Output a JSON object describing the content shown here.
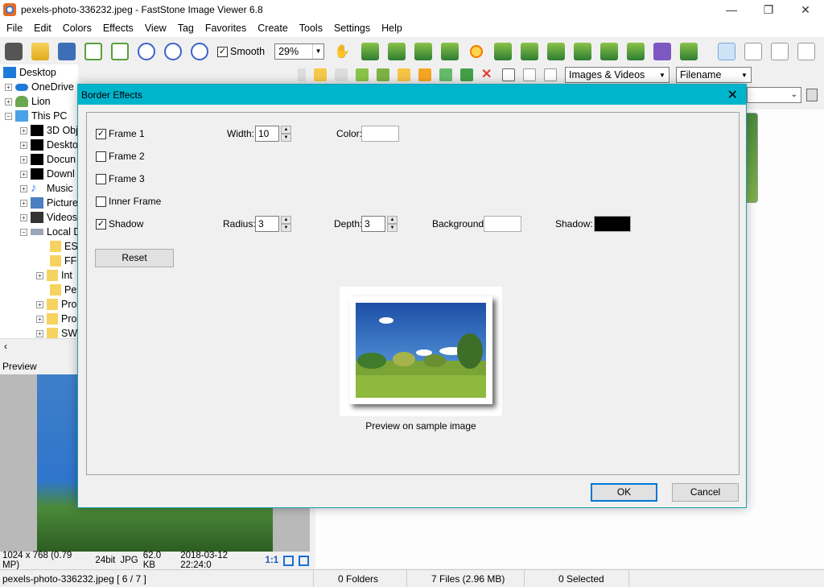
{
  "window": {
    "title": "pexels-photo-336232.jpeg - FastStone Image Viewer 6.8",
    "minimize": "—",
    "maximize": "❐",
    "close": "✕"
  },
  "menu": [
    "File",
    "Edit",
    "Colors",
    "Effects",
    "View",
    "Tag",
    "Favorites",
    "Create",
    "Tools",
    "Settings",
    "Help"
  ],
  "toolbar": {
    "smooth_label": "Smooth",
    "smooth_checked": "✓",
    "zoom_value": "29%"
  },
  "tree": {
    "items": [
      "Desktop",
      "OneDrive",
      "Lion",
      "This PC",
      "3D Obj",
      "Deskto",
      "Docun",
      "Downl",
      "Music",
      "Picture",
      "Videos",
      "Local D",
      "ESD",
      "FFO",
      "Int",
      "Per",
      "Pro",
      "Pro",
      "SW"
    ]
  },
  "browser": {
    "filter": "Images & Videos",
    "sort": "Filename"
  },
  "preview": {
    "label": "Preview",
    "dimensions": "1024 x 768 (0.79 MP)",
    "bits": "24bit",
    "format": "JPG",
    "size": "62.0 KB",
    "date": "2018-03-12 22:24:0",
    "ratio": "1:1"
  },
  "status": {
    "file": "pexels-photo-336232.jpeg [ 6 / 7 ]",
    "folders": "0 Folders",
    "files": "7 Files (2.96 MB)",
    "selected": "0 Selected"
  },
  "dialog": {
    "title": "Border Effects",
    "close": "✕",
    "frame1": "Frame 1",
    "frame2": "Frame 2",
    "frame3": "Frame 3",
    "inner_frame": "Inner Frame",
    "shadow": "Shadow",
    "check_mark": "✓",
    "width_label": "Width:",
    "width_value": "10",
    "color_label": "Color:",
    "radius_label": "Radius:",
    "radius_value": "3",
    "depth_label": "Depth:",
    "depth_value": "3",
    "background_label": "Background:",
    "shadow_label": "Shadow:",
    "reset": "Reset",
    "caption": "Preview on sample image",
    "ok": "OK",
    "cancel": "Cancel",
    "colors": {
      "frame_color": "#ffffff",
      "background": "#ffffff",
      "shadow": "#000000",
      "title_bar": "#00b4cc"
    }
  },
  "icons": [
    "camera-icon",
    "open-folder-icon",
    "save-icon",
    "prev-icon",
    "next-icon",
    "zoom-in-icon",
    "zoom-out-icon",
    "actual-size-icon",
    "hand-icon",
    "sun-icon",
    "printer-icon",
    "layout-icon"
  ]
}
